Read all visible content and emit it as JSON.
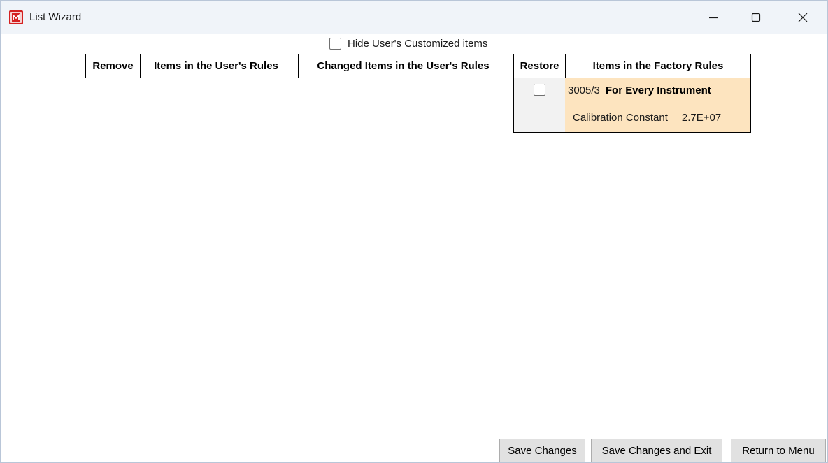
{
  "window": {
    "title": "List Wizard"
  },
  "options": {
    "hide_custom_label": "Hide User's Customized items",
    "hide_custom_checked": false
  },
  "grid": {
    "headers": {
      "remove": "Remove",
      "user_items": "Items in the User's Rules",
      "changed_items": "Changed Items in the User's Rules",
      "restore": "Restore",
      "factory_items": "Items in the Factory Rules"
    },
    "factory_rows": [
      {
        "code": "3005/3",
        "title": "For Every Instrument",
        "restore_checked": false
      },
      {
        "label": "Calibration Constant",
        "value": "2.7E+07"
      }
    ]
  },
  "buttons": {
    "save": "Save Changes",
    "save_exit": "Save Changes and Exit",
    "return": "Return to Menu"
  },
  "colors": {
    "factory_row_bg": "#fde4bf",
    "titlebar_bg": "#f0f4f9",
    "app_icon": "#d42020"
  }
}
